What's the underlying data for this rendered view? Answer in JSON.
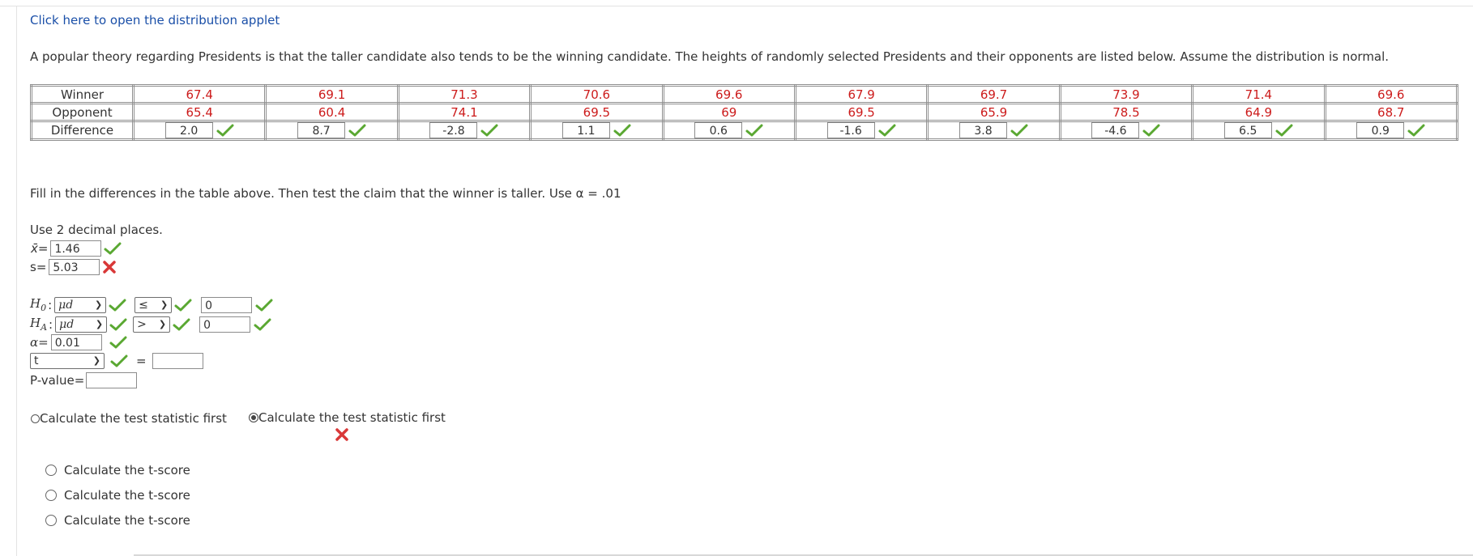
{
  "link_text": "Click here to open the distribution applet",
  "intro": "A popular theory regarding Presidents is that the taller candidate also tends to be the winning candidate. The heights of randomly selected Presidents and their opponents are listed below. Assume the distribution is normal.",
  "table": {
    "row_labels": [
      "Winner",
      "Opponent",
      "Difference"
    ],
    "winner": [
      "67.4",
      "69.1",
      "71.3",
      "70.6",
      "69.6",
      "67.9",
      "69.7",
      "73.9",
      "71.4",
      "69.6"
    ],
    "opponent": [
      "65.4",
      "60.4",
      "74.1",
      "69.5",
      "69",
      "69.5",
      "65.9",
      "78.5",
      "64.9",
      "68.7"
    ],
    "difference": [
      "2.0",
      "8.7",
      "-2.8",
      "1.1",
      "0.6",
      "-1.6",
      "3.8",
      "-4.6",
      "6.5",
      "0.9"
    ]
  },
  "instruction": "Fill in the differences in the table above. Then test the claim that the winner is taller. Use α = .01",
  "decimals_note": "Use 2 decimal places.",
  "xbar": {
    "label": "x̄=",
    "value": "1.46"
  },
  "s": {
    "label": "s=",
    "value": "5.03"
  },
  "h0": {
    "label_main": "H",
    "label_sub": "0",
    "param": "μd",
    "op": "≤",
    "value": "0"
  },
  "ha": {
    "label_main": "H",
    "label_sub": "A",
    "param": "μd",
    "op": ">",
    "value": "0"
  },
  "alpha": {
    "label": "α=",
    "value": "0.01"
  },
  "test": {
    "selected": "t",
    "equals": "=",
    "value": ""
  },
  "pvalue": {
    "label": "P-value=",
    "value": ""
  },
  "choice_a": "Calculate the test statistic first",
  "choice_b": "Calculate the test statistic first",
  "options": [
    "Calculate the t-score",
    "Calculate the t-score",
    "Calculate the t-score"
  ],
  "colors": {
    "check": "#5aa832",
    "cross": "#d93838",
    "red_text": "#cc1b1b",
    "link": "#1a4fa8"
  }
}
